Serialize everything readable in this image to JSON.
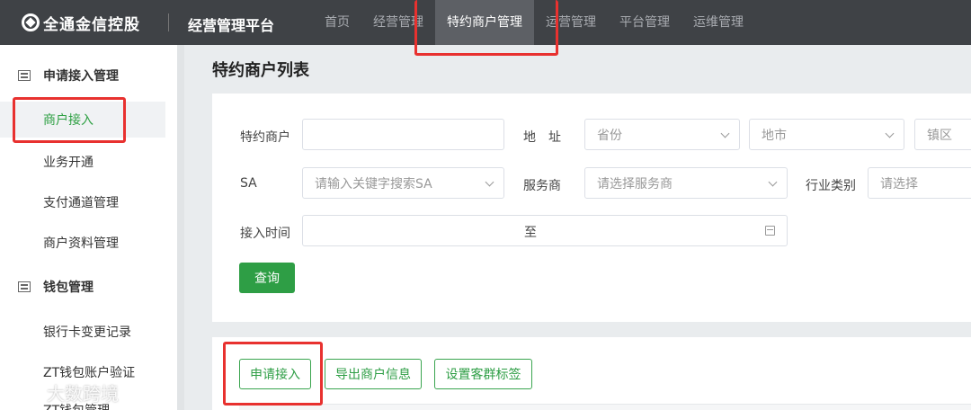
{
  "header": {
    "brand": "全通金信控股",
    "platform": "经营管理平台",
    "nav": [
      "首页",
      "经营管理",
      "特约商户管理",
      "运营管理",
      "平台管理",
      "运维管理"
    ]
  },
  "sidebar": {
    "group1": "申请接入管理",
    "items1": [
      "商户接入",
      "业务开通",
      "支付通道管理",
      "商户资料管理"
    ],
    "group2": "钱包管理",
    "items2": [
      "银行卡变更记录",
      "ZT钱包账户验证",
      "ZT钱包管理"
    ]
  },
  "page": {
    "title": "特约商户列表"
  },
  "form": {
    "merchant_label": "特约商户",
    "address_label": "地　址",
    "province_ph": "省份",
    "city_ph": "地市",
    "town_ph": "镇区",
    "sa_label": "SA",
    "sa_ph": "请输入关键字搜索SA",
    "provider_label": "服务商",
    "provider_ph": "请选择服务商",
    "industry_label": "行业类别",
    "industry_ph": "请选择",
    "time_label": "接入时间",
    "time_sep": "至",
    "query_button": "查询"
  },
  "actions": {
    "apply": "申请接入",
    "export": "导出商户信息",
    "tags": "设置客群标签"
  },
  "watermark": "大数跨境",
  "colors": {
    "accent": "#2e9e45",
    "highlight": "#e8312f",
    "topbar": "#3f4246"
  }
}
